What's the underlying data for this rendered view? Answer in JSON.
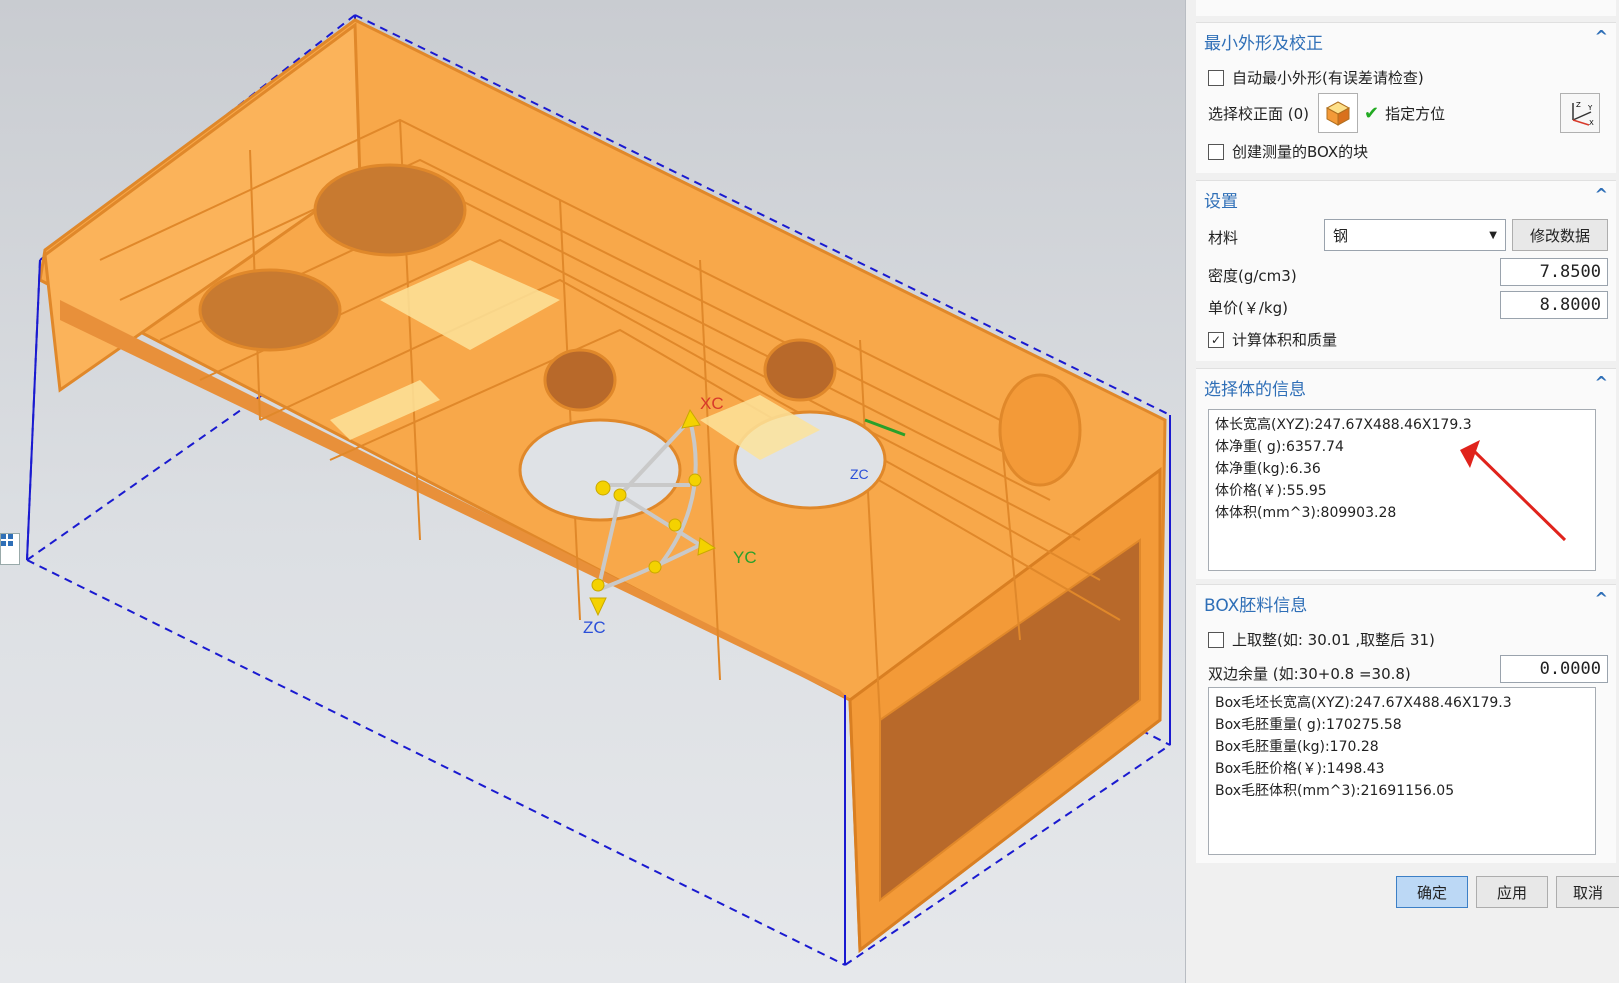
{
  "viewport": {
    "axes": {
      "x": "XC",
      "y": "YC",
      "z": "ZC",
      "z2": "ZC"
    },
    "colors": {
      "part": "#f8a84a",
      "edge": "#e08a2c",
      "box": "#1a1ad0"
    }
  },
  "panel": {
    "min_shape": {
      "title": "最小外形及校正",
      "auto_min_shape_label": "自动最小外形(有误差请检查)",
      "auto_min_shape_checked": false,
      "select_face_label": "选择校正面 (0)",
      "orient_label": "指定方位",
      "create_box_label": "创建测量的BOX的块",
      "create_box_checked": false
    },
    "settings": {
      "title": "设置",
      "material_label": "材料",
      "material_value": "钢",
      "modify_button": "修改数据",
      "density_label": "密度(g/cm3)",
      "density_value": "7.8500",
      "price_label": "单价(￥/kg)",
      "price_value": "8.8000",
      "calc_label": "计算体积和质量",
      "calc_checked": true
    },
    "body_info": {
      "title": "选择体的信息",
      "lines": [
        "体长宽高(XYZ):247.67X488.46X179.3",
        "体净重( g):6357.74",
        "体净重(kg):6.36",
        "体价格(￥):55.95",
        "体体积(mm^3):809903.28"
      ]
    },
    "box_info": {
      "title": "BOX胚料信息",
      "round_up_label": "上取整(如: 30.01 ,取整后 31)",
      "round_up_checked": false,
      "margin_label": "双边余量 (如:30+0.8 =30.8)",
      "margin_value": "0.0000",
      "lines": [
        "Box毛坯长宽高(XYZ):247.67X488.46X179.3",
        "Box毛胚重量( g):170275.58",
        "Box毛胚重量(kg):170.28",
        "Box毛胚价格(￥):1498.43",
        "Box毛胚体积(mm^3):21691156.05"
      ]
    },
    "buttons": {
      "ok": "确定",
      "apply": "应用",
      "cancel": "取消"
    }
  }
}
